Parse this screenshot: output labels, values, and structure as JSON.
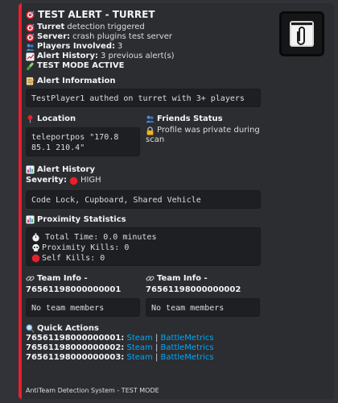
{
  "header": {
    "title": "TEST ALERT - TURRET"
  },
  "details": [
    {
      "key": "Turret",
      "value": "detection triggered"
    },
    {
      "key": "Server:",
      "value": "crash plugins test server"
    },
    {
      "key": "Players Involved:",
      "value": "3"
    },
    {
      "key": "Alert History:",
      "value": "3 previous alert(s)"
    },
    {
      "key": "TEST MODE ACTIVE",
      "value": ""
    }
  ],
  "alert_info": {
    "title": "Alert Information",
    "text": "TestPlayer1 authed on turret with 3+ players"
  },
  "location": {
    "title": "Location",
    "text1": "teleportpos \"170.8",
    "text2": "85.1 210.4\""
  },
  "friends": {
    "title": "Friends Status",
    "text1": "Profile was private during",
    "text2": "scan"
  },
  "alert_history": {
    "title": "Alert History",
    "severity_label": "Severity:",
    "severity_value": "HIGH",
    "items": "Code Lock, Cupboard, Shared Vehicle"
  },
  "proximity": {
    "title": "Proximity Statistics",
    "rows": [
      "Total Time: 0.0 minutes",
      "Proximity Kills: 0",
      "Self Kills: 0"
    ]
  },
  "team_info": [
    {
      "title": "Team Info -",
      "id": "76561198000000001",
      "text": "No team members"
    },
    {
      "title": "Team Info -",
      "id": "76561198000000002",
      "text": "No team members"
    }
  ],
  "quick_actions": {
    "title": "Quick Actions",
    "rows": [
      {
        "id": "76561198000000001:",
        "steam": "Steam",
        "sep": "|",
        "bm": "BattleMetrics"
      },
      {
        "id": "76561198000000002:",
        "steam": "Steam",
        "sep": "|",
        "bm": "BattleMetrics"
      },
      {
        "id": "76561198000000003:",
        "steam": "Steam",
        "sep": "|",
        "bm": "BattleMetrics"
      }
    ]
  },
  "footer": {
    "text": "AntiTeam Detection System - TEST MODE"
  },
  "colors": {
    "accent": "#e8202b",
    "link": "#00a8fc",
    "embed_bg": "#2b2d31",
    "code_bg": "#1e1f22"
  },
  "icons": {
    "title": "target-icon",
    "turret": "target-icon",
    "server": "target-icon",
    "players": "people-icon",
    "history": "chart-icon",
    "test": "test-tube-icon",
    "alert_info": "memo-icon",
    "location": "pin-icon",
    "friends": "people-icon",
    "friends_status": "lock-icon",
    "alert_history": "bar-chart-icon",
    "severity": "red-circle-icon",
    "proximity": "bar-chart-icon",
    "time": "stopwatch-icon",
    "kills": "skull-icon",
    "self_kills": "red-circle-icon",
    "team": "link-icon",
    "quick_actions": "magnifier-icon",
    "thumbnail": "turret-thumbnail"
  }
}
